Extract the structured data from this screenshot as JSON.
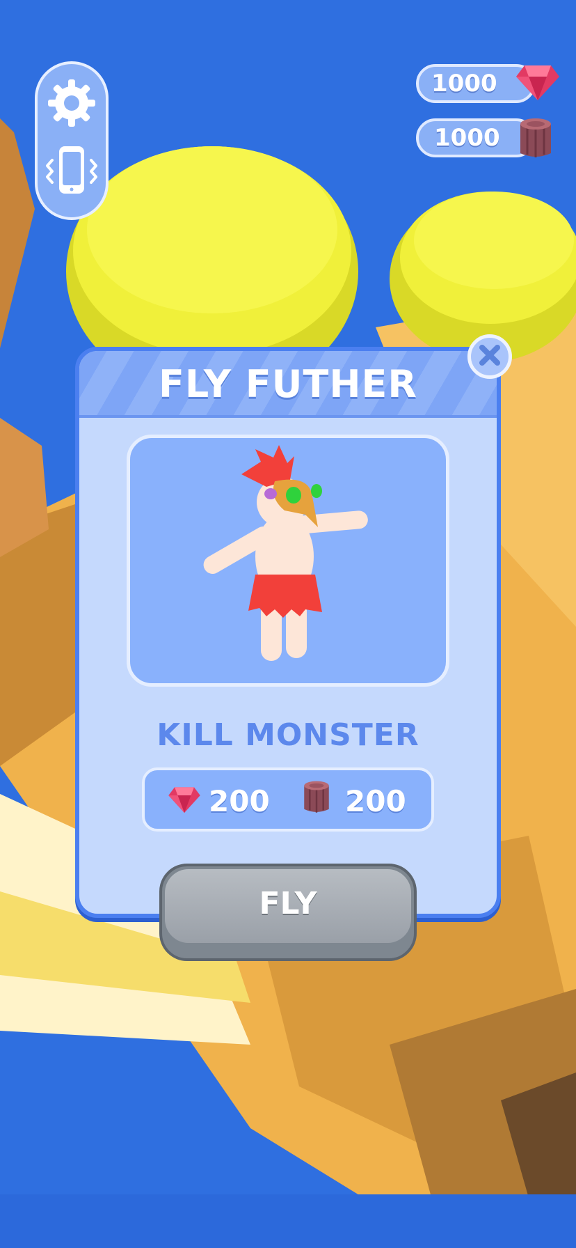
{
  "hud": {
    "settings_icon": "gear-icon",
    "vibration_icon": "phone-vibrate-icon",
    "gems": "1000",
    "wood": "1000"
  },
  "modal": {
    "title": "FLY FUTHER",
    "mission": "KILL MONSTER",
    "cost_gems": "200",
    "cost_wood": "200",
    "button_label": "FLY",
    "close_icon": "close-icon"
  },
  "colors": {
    "sky": "#2f6fe0",
    "panel": "#c5d9fd",
    "panel_border": "#4b7ff0",
    "gem": "#e23a63",
    "wood": "#8b4a57",
    "button_disabled": "#9aa0a8"
  }
}
